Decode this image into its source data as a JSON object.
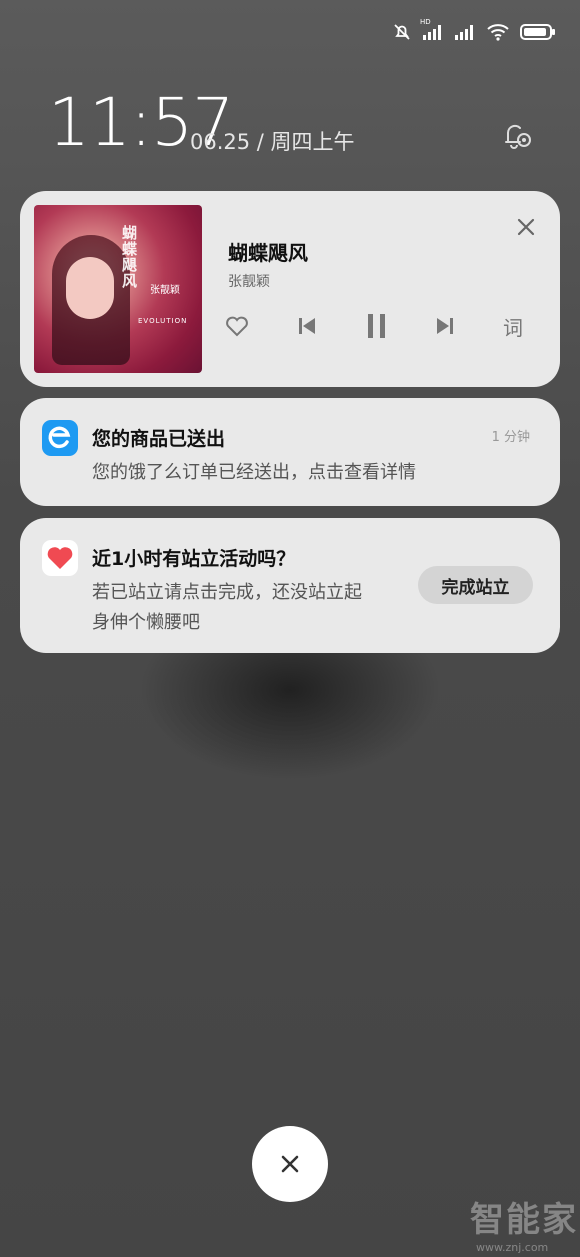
{
  "statusbar": {
    "network_badge": "HD",
    "icons": [
      "mute-icon",
      "signal-icon",
      "signal-icon",
      "wifi-icon",
      "battery-icon"
    ]
  },
  "lockscreen": {
    "time": "11:57",
    "date": "06.25 / 周四上午"
  },
  "music_card": {
    "song": "蝴蝶飓风",
    "artist": "张靓颖",
    "lyrics_label": "词",
    "cover_text": {
      "vertical": "蝴蝶飓风",
      "side": "张靓颖",
      "english": "EVOLUTION"
    }
  },
  "notifications": [
    {
      "title": "您的商品已送出",
      "body": "您的饿了么订单已经送出，点击查看详情",
      "time": "1 分钟",
      "icon_color": "#1e9af2"
    },
    {
      "title": "近1小时有站立活动吗？",
      "body_line1": "若已站立请点击完成，还没站立起",
      "body_line2": "身伸个懒腰吧",
      "action": "完成站立",
      "icon_color": "#f04a52"
    }
  ],
  "watermark": {
    "brand": "智能家",
    "url": "www.znj.com"
  }
}
